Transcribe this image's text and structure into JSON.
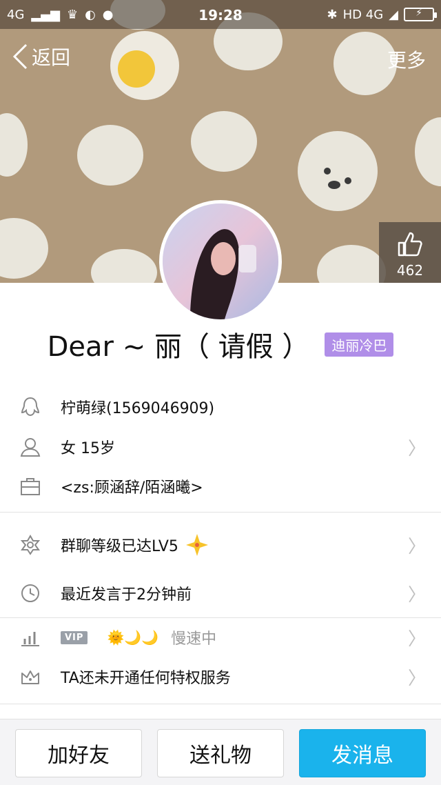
{
  "status_bar": {
    "network_left": "4G",
    "time": "19:28",
    "network_right": "HD 4G",
    "battery_symbol": "⚡"
  },
  "nav": {
    "back_label": "返回",
    "more_label": "更多"
  },
  "profile": {
    "likes": "462",
    "name": "Dear ~ 丽（ 请假 ）",
    "group_tag": "迪丽冷巴"
  },
  "info": {
    "qq": "柠萌绿(1569046909)",
    "gender_age": "女  15岁",
    "company": "<zs:顾涵辞/陌涵曦>"
  },
  "group": {
    "level": "群聊等级已达LV5",
    "last_speak": "最近发言于2分钟前"
  },
  "privilege": {
    "vip_badge": "VIP",
    "level_icons": "🌞🌙🌙",
    "speed": "慢速中",
    "service": "TA还未开通任何特权服务"
  },
  "actions": {
    "add_friend": "加好友",
    "send_gift": "送礼物",
    "send_message": "发消息"
  },
  "colors": {
    "accent_blue": "#1ab3ec",
    "tag_purple": "#b08ee8",
    "banner_brown": "#b19a7c"
  }
}
